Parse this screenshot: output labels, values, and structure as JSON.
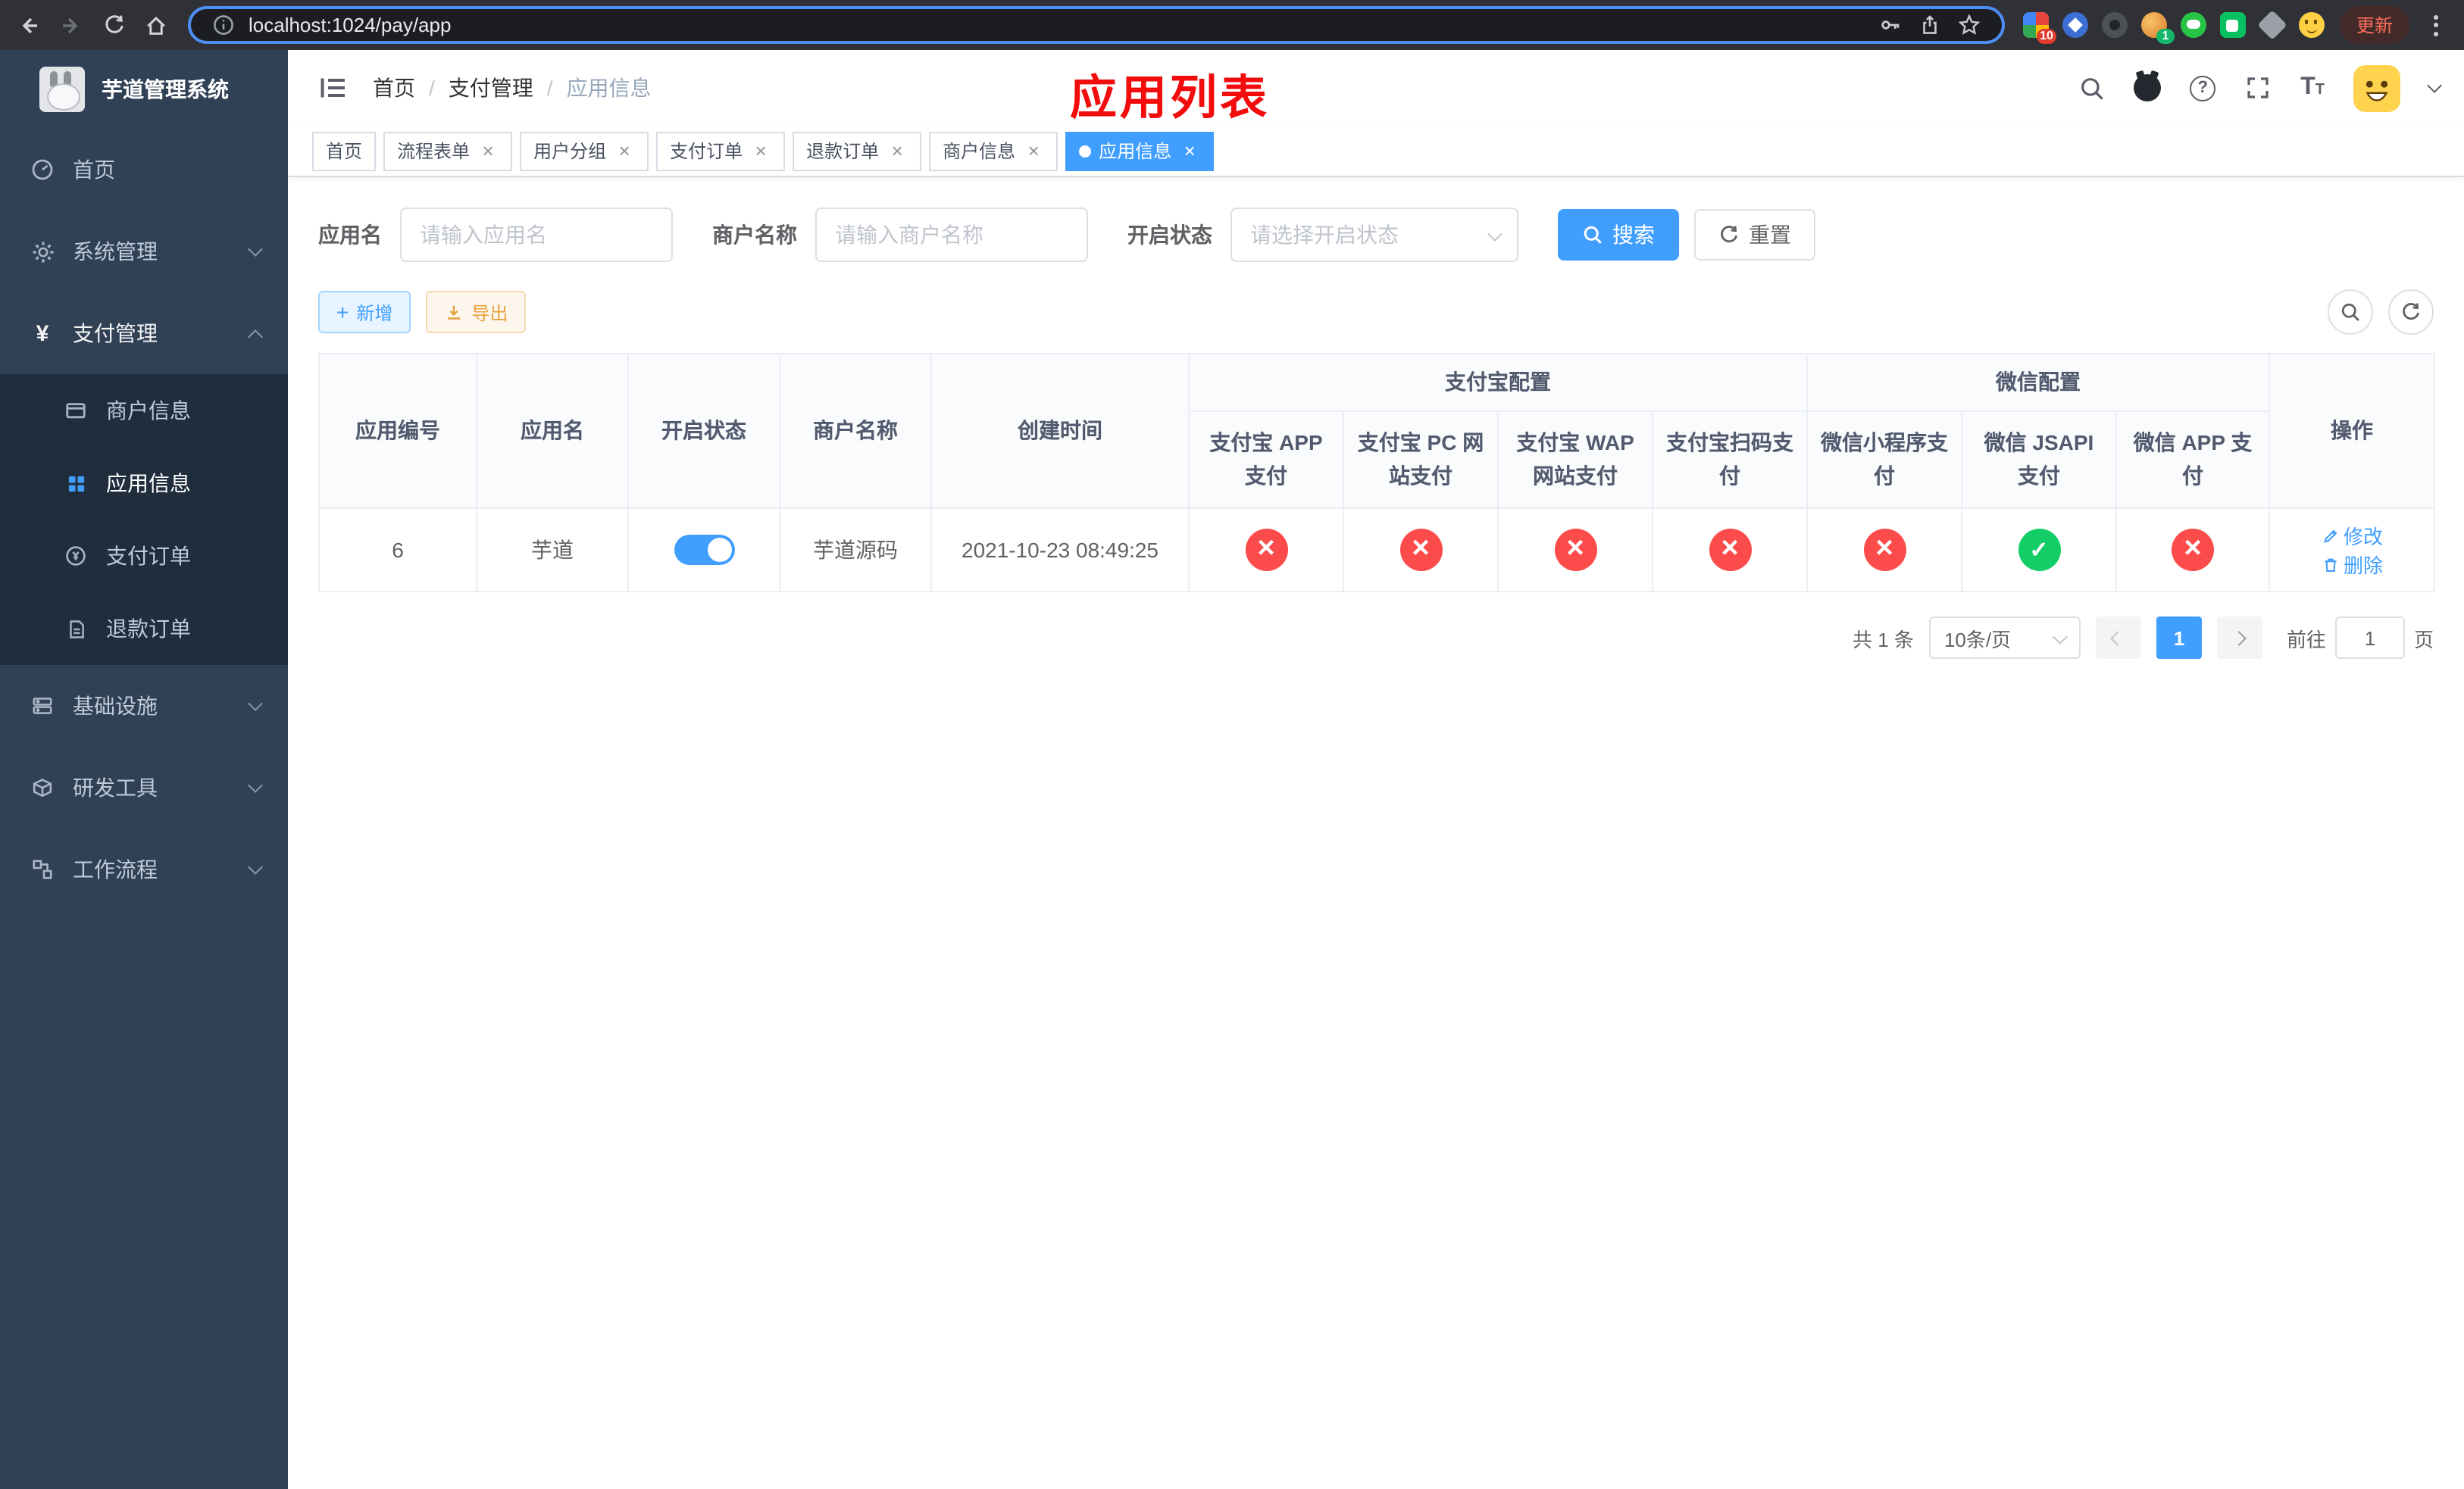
{
  "browser": {
    "url": "localhost:1024/pay/app",
    "update_label": "更新",
    "ext_badge_grid": "10",
    "ext_badge_avatar": "1"
  },
  "sidebar": {
    "title": "芋道管理系统",
    "items": {
      "home": "首页",
      "system": "系统管理",
      "payment": "支付管理",
      "merchant": "商户信息",
      "app_info": "应用信息",
      "pay_order": "支付订单",
      "refund_order": "退款订单",
      "infra": "基础设施",
      "dev": "研发工具",
      "workflow": "工作流程"
    }
  },
  "header": {
    "breadcrumb": [
      "首页",
      "支付管理",
      "应用信息"
    ],
    "annotation": "应用列表"
  },
  "tabs": [
    {
      "label": "首页",
      "closable": false
    },
    {
      "label": "流程表单",
      "closable": true
    },
    {
      "label": "用户分组",
      "closable": true
    },
    {
      "label": "支付订单",
      "closable": true
    },
    {
      "label": "退款订单",
      "closable": true
    },
    {
      "label": "商户信息",
      "closable": true
    },
    {
      "label": "应用信息",
      "closable": true,
      "active": true
    }
  ],
  "filters": {
    "app_name_label": "应用名",
    "app_name_placeholder": "请输入应用名",
    "merchant_label": "商户名称",
    "merchant_placeholder": "请输入商户名称",
    "status_label": "开启状态",
    "status_placeholder": "请选择开启状态",
    "search_label": "搜索",
    "reset_label": "重置"
  },
  "toolbar": {
    "add_label": "新增",
    "export_label": "导出"
  },
  "table": {
    "headers": {
      "app_id": "应用编号",
      "app_name": "应用名",
      "status": "开启状态",
      "merchant": "商户名称",
      "create_time": "创建时间",
      "alipay_group": "支付宝配置",
      "wechat_group": "微信配置",
      "alipay_app": "支付宝 APP 支付",
      "alipay_pc": "支付宝 PC 网站支付",
      "alipay_wap": "支付宝 WAP 网站支付",
      "alipay_qr": "支付宝扫码支付",
      "wx_lite": "微信小程序支付",
      "wx_jsapi": "微信 JSAPI 支付",
      "wx_app": "微信 APP 支付",
      "actions": "操作"
    },
    "row": {
      "app_id": "6",
      "app_name": "芋道",
      "status_state": "on",
      "merchant": "芋道源码",
      "create_time": "2021-10-23 08:49:25",
      "alipay_app": "disabled",
      "alipay_pc": "disabled",
      "alipay_wap": "disabled",
      "alipay_qr": "disabled",
      "wx_lite": "disabled",
      "wx_jsapi": "enabled",
      "wx_app": "disabled",
      "edit_label": "修改",
      "delete_label": "删除"
    }
  },
  "pagination": {
    "total": "共 1 条",
    "page_size": "10条/页",
    "current_page": "1",
    "goto_label": "前往",
    "goto_value": "1",
    "page_suffix": "页"
  },
  "colors": {
    "primary": "#409eff",
    "success": "#13ce66",
    "danger": "#fb4b4b",
    "sidebar_bg": "#304156",
    "submenu_bg": "#1f2d3d",
    "annotation_red": "#f20c0c"
  }
}
